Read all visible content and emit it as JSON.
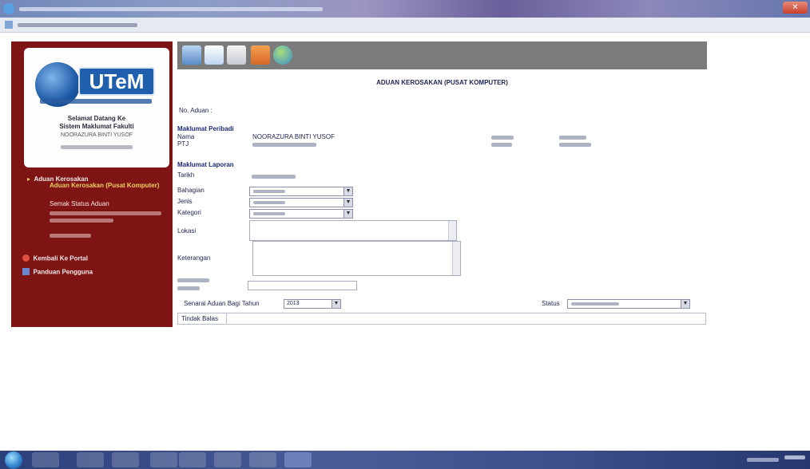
{
  "window": {
    "close_glyph": "✕"
  },
  "sidebar": {
    "logo_text": "UTeM",
    "welcome_line1": "Selamat Datang Ke",
    "welcome_line2": "Sistem Maklumat Fakulti",
    "user_name": "NOORAZURA BINTI YUSOF",
    "menu_header": "Aduan Kerosakan",
    "menu_items": [
      "Aduan Kerosakan (Pusat Komputer)",
      "Semak Status Aduan"
    ],
    "links": [
      "Kembali Ke Portal",
      "Panduan Pengguna"
    ]
  },
  "toolbar": {
    "icons": [
      "home-icon",
      "document-icon",
      "print-icon",
      "stop-icon",
      "globe-icon"
    ]
  },
  "form": {
    "title": "ADUAN KEROSAKAN (PUSAT KOMPUTER)",
    "no_aduan_label": "No. Aduan :",
    "section_peribadi": "Maklumat Peribadi",
    "nama_label": "Nama",
    "nama_value": "NOORAZURA BINTI YUSOF",
    "ptj_label": "PTJ",
    "section_laporan": "Maklumat Laporan",
    "tarikh_label": "Tarikh",
    "bahagian_label": "Bahagian",
    "jenis_label": "Jenis",
    "kategori_label": "Kategori",
    "lokasi_label": "Lokasi",
    "keterangan_label": "Keterangan",
    "senarai_label": "Senarai Aduan Bagi Tahun",
    "tahun_value": "2013",
    "status_label": "Status",
    "tindak_balas_label": "Tindak Balas"
  },
  "colors": {
    "sidebar": "#7f1414",
    "menu_highlight": "#f0d060",
    "toolbar": "#7b7b7b",
    "logo_blue": "#1f5fae"
  }
}
